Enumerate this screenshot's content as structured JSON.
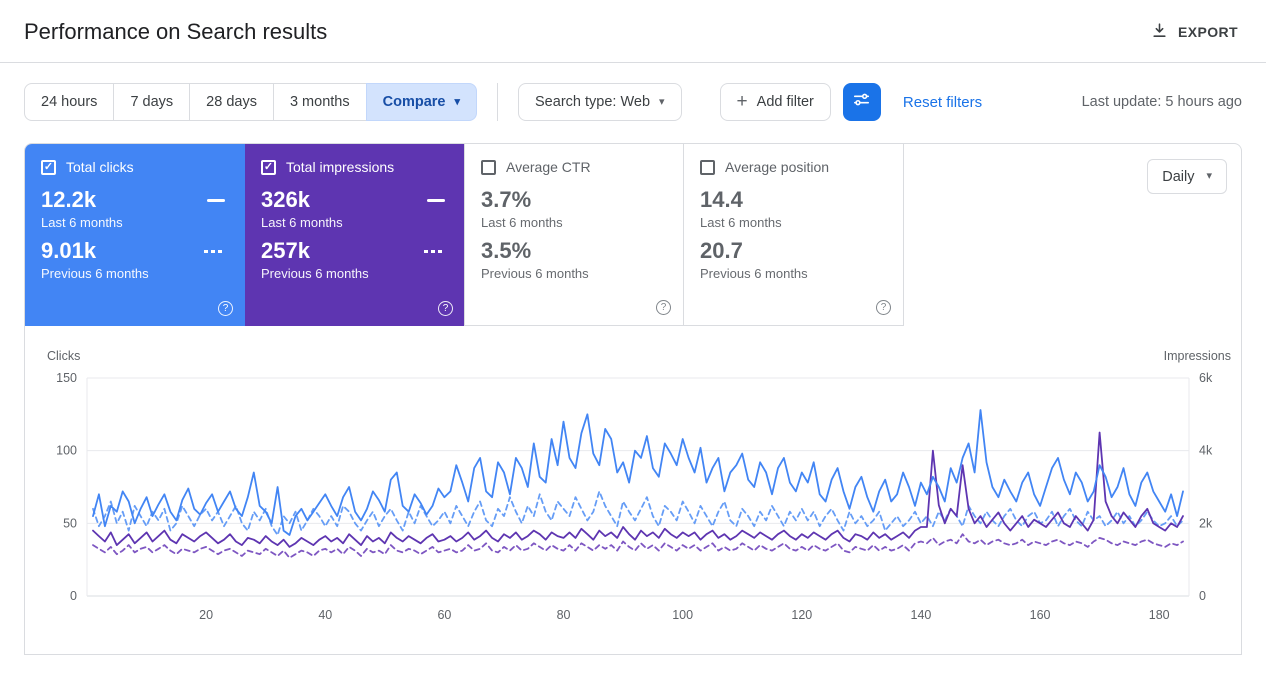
{
  "header": {
    "title": "Performance on Search results",
    "export_label": "EXPORT"
  },
  "filters": {
    "ranges": [
      "24 hours",
      "7 days",
      "28 days",
      "3 months"
    ],
    "compare_label": "Compare",
    "search_type_label": "Search type: Web",
    "add_filter_label": "Add filter",
    "reset_label": "Reset filters",
    "last_update": "Last update: 5 hours ago"
  },
  "icons": {
    "dropdown_caret": "▾",
    "add_icon": "+",
    "help_icon": "?",
    "checkbox_check": "✓"
  },
  "metrics": {
    "granularity_label": "Daily",
    "cards": [
      {
        "label": "Total clicks",
        "checked": true,
        "color": "#4285f4",
        "current": "12.2k",
        "current_caption": "Last 6 months",
        "previous": "9.01k",
        "previous_caption": "Previous 6 months"
      },
      {
        "label": "Total impressions",
        "checked": true,
        "color": "#5e35b1",
        "current": "326k",
        "current_caption": "Last 6 months",
        "previous": "257k",
        "previous_caption": "Previous 6 months"
      },
      {
        "label": "Average CTR",
        "checked": false,
        "color": "#ffffff",
        "current": "3.7%",
        "current_caption": "Last 6 months",
        "previous": "3.5%",
        "previous_caption": "Previous 6 months"
      },
      {
        "label": "Average position",
        "checked": false,
        "color": "#ffffff",
        "current": "14.4",
        "current_caption": "Last 6 months",
        "previous": "20.7",
        "previous_caption": "Previous 6 months"
      }
    ]
  },
  "chart_data": {
    "type": "line",
    "x_max": 185,
    "x_label_ticks": [
      20,
      40,
      60,
      80,
      100,
      120,
      140,
      160,
      180
    ],
    "left_axis": {
      "label": "Clicks",
      "max": 150,
      "ticks": [
        "0",
        "50",
        "100",
        "150"
      ]
    },
    "right_axis": {
      "label": "Impressions",
      "max": 6000,
      "ticks": [
        "0",
        "2k",
        "4k",
        "6k"
      ]
    },
    "grid": true,
    "legend_position": "none",
    "series": [
      {
        "name": "Clicks - Last 6 months",
        "axis": "left",
        "style": "solid",
        "color": "#4285f4",
        "values": [
          55,
          70,
          48,
          62,
          58,
          72,
          65,
          50,
          60,
          68,
          55,
          63,
          70,
          58,
          52,
          66,
          74,
          60,
          56,
          64,
          70,
          58,
          65,
          72,
          60,
          55,
          68,
          85,
          62,
          58,
          50,
          75,
          45,
          42,
          55,
          60,
          52,
          58,
          64,
          70,
          62,
          55,
          68,
          75,
          58,
          52,
          60,
          72,
          66,
          58,
          80,
          85,
          62,
          58,
          70,
          64,
          56,
          62,
          74,
          68,
          72,
          90,
          78,
          65,
          88,
          95,
          72,
          68,
          92,
          85,
          70,
          95,
          88,
          75,
          105,
          82,
          78,
          108,
          90,
          120,
          95,
          88,
          112,
          125,
          98,
          90,
          115,
          108,
          85,
          92,
          78,
          100,
          95,
          110,
          88,
          82,
          105,
          98,
          90,
          108,
          95,
          85,
          102,
          78,
          88,
          95,
          72,
          85,
          90,
          98,
          80,
          75,
          92,
          85,
          70,
          88,
          95,
          78,
          72,
          85,
          78,
          92,
          70,
          65,
          80,
          88,
          72,
          60,
          75,
          82,
          68,
          58,
          72,
          80,
          65,
          70,
          85,
          75,
          62,
          78,
          70,
          82,
          75,
          65,
          88,
          78,
          95,
          105,
          85,
          128,
          92,
          75,
          68,
          80,
          72,
          65,
          78,
          85,
          70,
          62,
          75,
          88,
          95,
          80,
          70,
          85,
          78,
          65,
          72,
          90,
          82,
          68,
          75,
          88,
          70,
          62,
          78,
          85,
          72,
          65,
          58,
          70,
          55,
          72
        ]
      },
      {
        "name": "Clicks - Previous 6 months",
        "axis": "left",
        "style": "dashed",
        "color": "#669df6",
        "values": [
          60,
          48,
          55,
          65,
          50,
          58,
          45,
          62,
          55,
          48,
          58,
          52,
          60,
          45,
          50,
          62,
          55,
          48,
          56,
          60,
          52,
          58,
          48,
          55,
          62,
          50,
          45,
          58,
          52,
          60,
          48,
          42,
          55,
          50,
          58,
          45,
          52,
          60,
          55,
          48,
          55,
          48,
          62,
          58,
          50,
          45,
          52,
          58,
          48,
          55,
          60,
          52,
          45,
          58,
          50,
          62,
          55,
          48,
          52,
          58,
          50,
          62,
          55,
          48,
          58,
          65,
          52,
          48,
          60,
          55,
          68,
          58,
          50,
          62,
          55,
          70,
          58,
          52,
          65,
          60,
          55,
          68,
          60,
          52,
          58,
          72,
          62,
          55,
          48,
          65,
          58,
          52,
          60,
          68,
          55,
          48,
          62,
          58,
          52,
          65,
          58,
          50,
          62,
          55,
          48,
          58,
          65,
          52,
          48,
          60,
          55,
          48,
          58,
          52,
          62,
          55,
          48,
          58,
          52,
          60,
          52,
          58,
          48,
          55,
          60,
          52,
          45,
          58,
          50,
          55,
          48,
          52,
          58,
          45,
          50,
          55,
          48,
          52,
          58,
          50,
          55,
          48,
          58,
          52,
          60,
          55,
          48,
          62,
          55,
          50,
          58,
          52,
          48,
          55,
          60,
          52,
          48,
          55,
          58,
          50,
          52,
          58,
          48,
          55,
          60,
          52,
          48,
          58,
          52,
          55,
          48,
          52,
          58,
          50,
          55,
          48,
          52,
          58,
          52,
          48,
          50,
          55,
          48,
          52
        ]
      },
      {
        "name": "Impressions - Last 6 months",
        "axis": "right",
        "style": "solid",
        "color": "#5e35b1",
        "values": [
          1800,
          1650,
          1500,
          1750,
          1400,
          1550,
          1700,
          1450,
          1600,
          1750,
          1500,
          1650,
          1800,
          1550,
          1450,
          1700,
          1600,
          1500,
          1650,
          1750,
          1600,
          1450,
          1550,
          1700,
          1500,
          1400,
          1600,
          1550,
          1450,
          1650,
          1500,
          1400,
          1550,
          1350,
          1450,
          1600,
          1500,
          1400,
          1550,
          1650,
          1500,
          1600,
          1450,
          1700,
          1550,
          1400,
          1650,
          1500,
          1600,
          1450,
          1750,
          1600,
          1500,
          1650,
          1550,
          1450,
          1600,
          1700,
          1500,
          1550,
          1650,
          1500,
          1600,
          1750,
          1550,
          1650,
          1800,
          1600,
          1500,
          1700,
          1600,
          1750,
          1550,
          1650,
          1800,
          1700,
          1550,
          1750,
          1650,
          1600,
          1750,
          1600,
          1850,
          1700,
          1550,
          1800,
          1650,
          1750,
          1600,
          1900,
          1700,
          1550,
          1800,
          1650,
          1750,
          1600,
          1850,
          1700,
          1600,
          1750,
          1650,
          1750,
          1550,
          1700,
          1800,
          1600,
          1700,
          1550,
          1650,
          1800,
          1700,
          1600,
          1750,
          1650,
          1550,
          1700,
          1800,
          1650,
          1550,
          1700,
          1600,
          1750,
          1650,
          1550,
          1700,
          1800,
          1600,
          1500,
          1700,
          1650,
          1550,
          1750,
          1600,
          1700,
          1550,
          1650,
          1750,
          1600,
          1800,
          1900,
          1900,
          4000,
          2500,
          2000,
          2400,
          2200,
          3600,
          2400,
          2000,
          2200,
          1900,
          2100,
          2300,
          2000,
          1800,
          2000,
          2200,
          1900,
          2100,
          2000,
          1900,
          2100,
          2300,
          2000,
          1900,
          2200,
          2000,
          1800,
          2100,
          4500,
          2600,
          2200,
          2000,
          2300,
          2100,
          1900,
          2200,
          2400,
          2000,
          1900,
          1800,
          2000,
          1900,
          2200
        ]
      },
      {
        "name": "Impressions - Previous 6 months",
        "axis": "right",
        "style": "dashed",
        "color": "#7e57c2",
        "values": [
          1400,
          1300,
          1200,
          1350,
          1150,
          1250,
          1400,
          1200,
          1300,
          1350,
          1200,
          1300,
          1400,
          1250,
          1150,
          1300,
          1250,
          1200,
          1300,
          1350,
          1250,
          1150,
          1250,
          1300,
          1200,
          1100,
          1250,
          1200,
          1150,
          1300,
          1200,
          1100,
          1250,
          1050,
          1150,
          1250,
          1200,
          1100,
          1250,
          1300,
          1200,
          1300,
          1150,
          1350,
          1250,
          1100,
          1300,
          1200,
          1250,
          1150,
          1400,
          1250,
          1200,
          1300,
          1250,
          1150,
          1250,
          1350,
          1200,
          1250,
          1300,
          1200,
          1250,
          1400,
          1250,
          1300,
          1450,
          1250,
          1200,
          1350,
          1250,
          1400,
          1250,
          1300,
          1450,
          1350,
          1250,
          1400,
          1300,
          1250,
          1400,
          1250,
          1450,
          1350,
          1250,
          1400,
          1300,
          1400,
          1250,
          1500,
          1350,
          1250,
          1450,
          1300,
          1400,
          1250,
          1450,
          1350,
          1250,
          1400,
          1300,
          1400,
          1250,
          1350,
          1450,
          1250,
          1350,
          1250,
          1300,
          1450,
          1350,
          1250,
          1400,
          1300,
          1250,
          1350,
          1450,
          1300,
          1250,
          1350,
          1250,
          1400,
          1300,
          1250,
          1350,
          1450,
          1250,
          1200,
          1350,
          1300,
          1250,
          1400,
          1250,
          1350,
          1250,
          1300,
          1400,
          1250,
          1450,
          1500,
          1450,
          1600,
          1400,
          1500,
          1550,
          1450,
          1700,
          1500,
          1450,
          1550,
          1400,
          1500,
          1550,
          1450,
          1400,
          1450,
          1550,
          1400,
          1500,
          1450,
          1400,
          1500,
          1550,
          1450,
          1400,
          1500,
          1450,
          1350,
          1500,
          1600,
          1550,
          1450,
          1400,
          1500,
          1450,
          1400,
          1500,
          1550,
          1450,
          1400,
          1350,
          1450,
          1400,
          1500
        ]
      }
    ]
  }
}
